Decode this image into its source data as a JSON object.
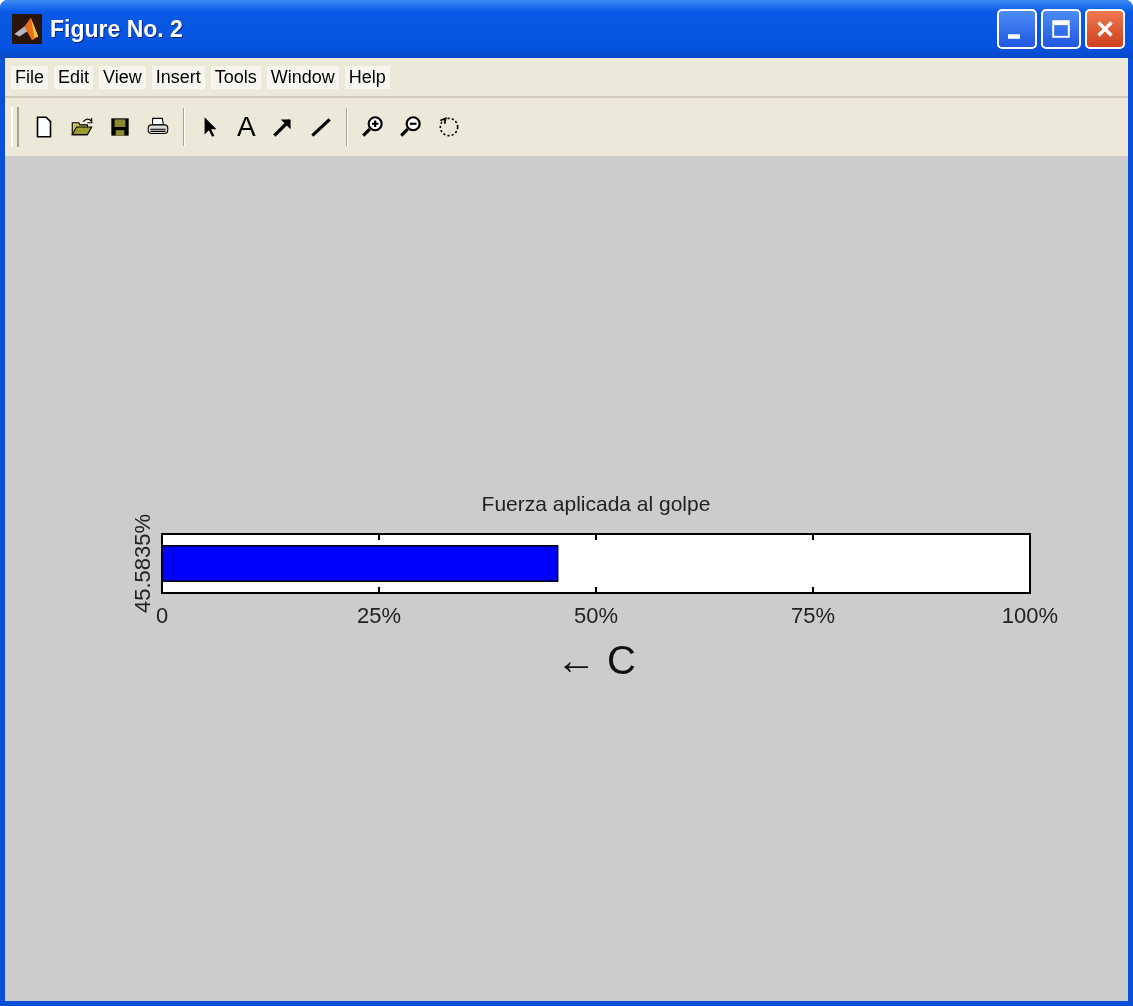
{
  "window": {
    "title": "Figure No. 2"
  },
  "menu": [
    {
      "label": "File"
    },
    {
      "label": "Edit"
    },
    {
      "label": "View"
    },
    {
      "label": "Insert"
    },
    {
      "label": "Tools"
    },
    {
      "label": "Window"
    },
    {
      "label": "Help"
    }
  ],
  "toolbar": {
    "text_tool_label": "A"
  },
  "figure": {
    "chart_data": {
      "type": "bar",
      "orientation": "horizontal",
      "title": "Fuerza aplicada al golpe",
      "xlabel": "← C",
      "categories": [
        "45.5835%"
      ],
      "series": [
        {
          "color": "#0000ff",
          "values": [
            45.5835
          ]
        }
      ],
      "xlim": [
        0,
        100
      ],
      "xticks": [
        {
          "value": 0,
          "label": "0"
        },
        {
          "value": 25,
          "label": "25%"
        },
        {
          "value": 50,
          "label": "50%"
        },
        {
          "value": 75,
          "label": "75%"
        },
        {
          "value": 100,
          "label": "100%"
        }
      ]
    }
  }
}
